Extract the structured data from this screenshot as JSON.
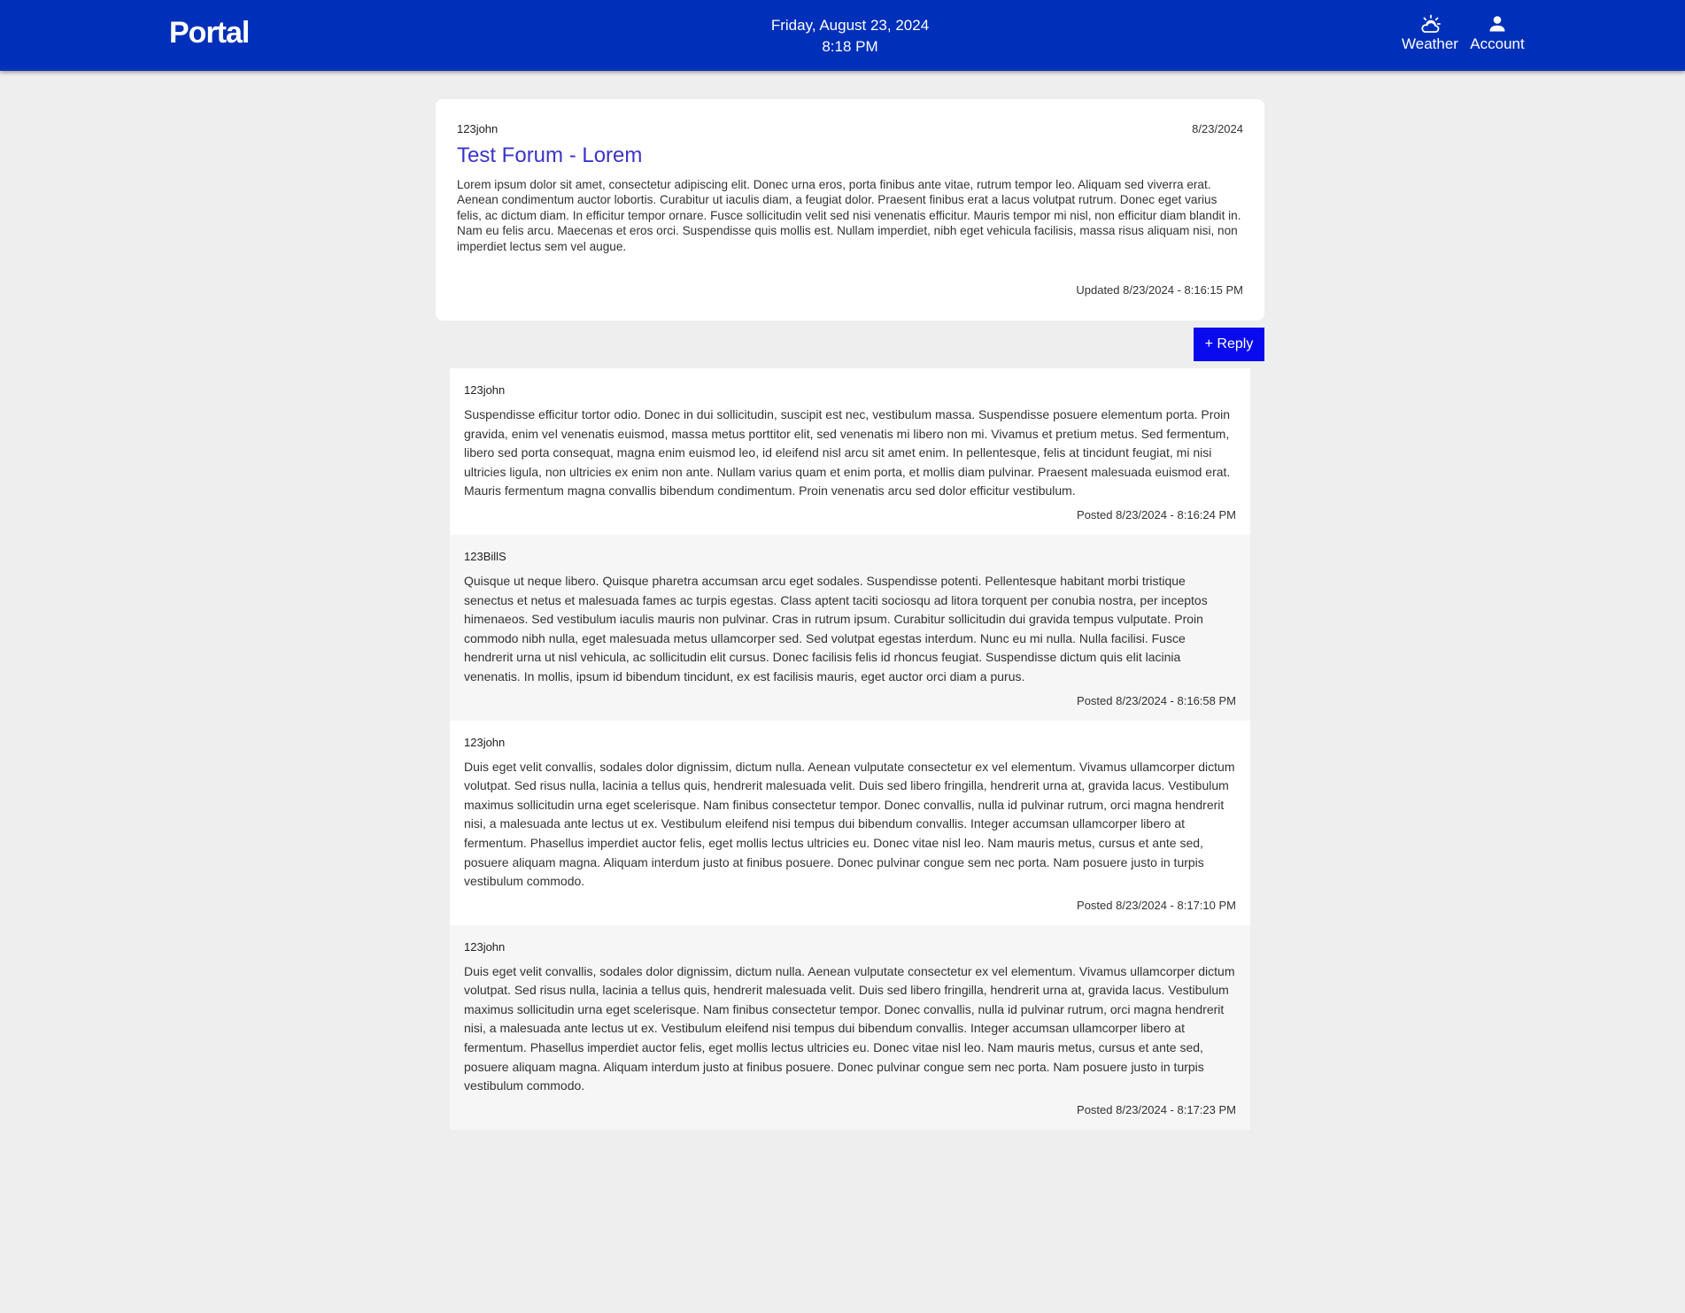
{
  "header": {
    "brand": "Portal",
    "date": "Friday, August 23, 2024",
    "time": "8:18 PM",
    "weather_label": "Weather",
    "account_label": "Account",
    "background": "#0030b9"
  },
  "post": {
    "author": "123john",
    "date": "8/23/2024",
    "title": "Test Forum - Lorem",
    "body": "Lorem ipsum dolor sit amet, consectetur adipiscing elit. Donec urna eros, porta finibus ante vitae, rutrum tempor leo. Aliquam sed viverra erat. Aenean condimentum auctor lobortis. Curabitur ut iaculis diam, a feugiat dolor. Praesent finibus erat a lacus volutpat rutrum. Donec eget varius felis, ac dictum diam. In efficitur tempor ornare. Fusce sollicitudin velit sed nisi venenatis efficitur. Mauris tempor mi nisl, non efficitur diam blandit in. Nam eu felis arcu. Maecenas et eros orci. Suspendisse quis mollis est. Nullam imperdiet, nibh eget vehicula facilisis, massa risus aliquam nisi, non imperdiet lectus sem vel augue.",
    "updated": "Updated 8/23/2024 - 8:16:15 PM",
    "title_color": "#3b34c9"
  },
  "reply_button": {
    "label": "+ Reply",
    "color": "#0a0aee"
  },
  "replies": [
    {
      "author": "123john",
      "text": "Suspendisse efficitur tortor odio. Donec in dui sollicitudin, suscipit est nec, vestibulum massa. Suspendisse posuere elementum porta. Proin gravida, enim vel venenatis euismod, massa metus porttitor elit, sed venenatis mi libero non mi. Vivamus et pretium metus. Sed fermentum, libero sed porta consequat, magna enim euismod leo, id eleifend nisl arcu sit amet enim. In pellentesque, felis at tincidunt feugiat, mi nisi ultricies ligula, non ultricies ex enim non ante. Nullam varius quam et enim porta, et mollis diam pulvinar. Praesent malesuada euismod erat. Mauris fermentum magna convallis bibendum condimentum. Proin venenatis arcu sed dolor efficitur vestibulum.",
      "posted": "Posted 8/23/2024 - 8:16:24 PM"
    },
    {
      "author": "123BillS",
      "text": "Quisque ut neque libero. Quisque pharetra accumsan arcu eget sodales. Suspendisse potenti. Pellentesque habitant morbi tristique senectus et netus et malesuada fames ac turpis egestas. Class aptent taciti sociosqu ad litora torquent per conubia nostra, per inceptos himenaeos. Sed vestibulum iaculis mauris non pulvinar. Cras in rutrum ipsum. Curabitur sollicitudin dui gravida tempus vulputate. Proin commodo nibh nulla, eget malesuada metus ullamcorper sed. Sed volutpat egestas interdum. Nunc eu mi nulla. Nulla facilisi. Fusce hendrerit urna ut nisl vehicula, ac sollicitudin elit cursus. Donec facilisis felis id rhoncus feugiat. Suspendisse dictum quis elit lacinia venenatis. In mollis, ipsum id bibendum tincidunt, ex est facilisis mauris, eget auctor orci diam a purus.",
      "posted": "Posted 8/23/2024 - 8:16:58 PM"
    },
    {
      "author": "123john",
      "text": "Duis eget velit convallis, sodales dolor dignissim, dictum nulla. Aenean vulputate consectetur ex vel elementum. Vivamus ullamcorper dictum volutpat. Sed risus nulla, lacinia a tellus quis, hendrerit malesuada velit. Duis sed libero fringilla, hendrerit urna at, gravida lacus. Vestibulum maximus sollicitudin urna eget scelerisque. Nam finibus consectetur tempor. Donec convallis, nulla id pulvinar rutrum, orci magna hendrerit nisi, a malesuada ante lectus ut ex. Vestibulum eleifend nisi tempus dui bibendum convallis. Integer accumsan ullamcorper libero at fermentum. Phasellus imperdiet auctor felis, eget mollis lectus ultricies eu. Donec vitae nisl leo. Nam mauris metus, cursus et ante sed, posuere aliquam magna. Aliquam interdum justo at finibus posuere. Donec pulvinar congue sem nec porta. Nam posuere justo in turpis vestibulum commodo.",
      "posted": "Posted 8/23/2024 - 8:17:10 PM"
    },
    {
      "author": "123john",
      "text": "Duis eget velit convallis, sodales dolor dignissim, dictum nulla. Aenean vulputate consectetur ex vel elementum. Vivamus ullamcorper dictum volutpat. Sed risus nulla, lacinia a tellus quis, hendrerit malesuada velit. Duis sed libero fringilla, hendrerit urna at, gravida lacus. Vestibulum maximus sollicitudin urna eget scelerisque. Nam finibus consectetur tempor. Donec convallis, nulla id pulvinar rutrum, orci magna hendrerit nisi, a malesuada ante lectus ut ex. Vestibulum eleifend nisi tempus dui bibendum convallis. Integer accumsan ullamcorper libero at fermentum. Phasellus imperdiet auctor felis, eget mollis lectus ultricies eu. Donec vitae nisl leo. Nam mauris metus, cursus et ante sed, posuere aliquam magna. Aliquam interdum justo at finibus posuere. Donec pulvinar congue sem nec porta. Nam posuere justo in turpis vestibulum commodo.",
      "posted": "Posted 8/23/2024 - 8:17:23 PM"
    }
  ]
}
